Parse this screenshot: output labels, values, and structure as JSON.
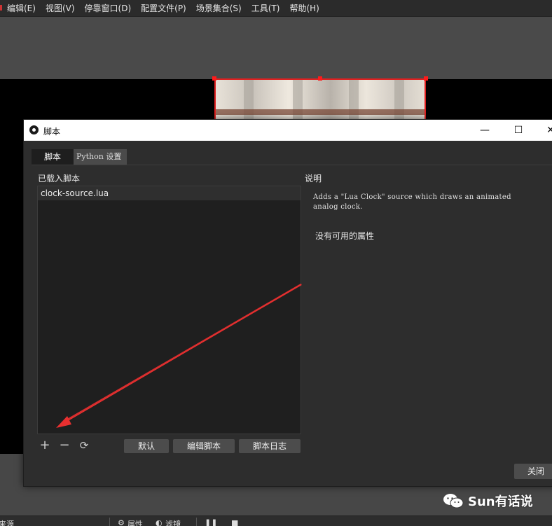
{
  "menu": {
    "items": [
      "编辑(E)",
      "视图(V)",
      "停靠窗口(D)",
      "配置文件(P)",
      "场景集合(S)",
      "工具(T)",
      "帮助(H)"
    ]
  },
  "dialog": {
    "title": "脚本",
    "controls": {
      "minimize": "—",
      "maximize": "☐",
      "close": "✕"
    },
    "tabs": [
      "脚本",
      "Python 设置"
    ],
    "loaded_scripts_label": "已载入脚本",
    "scripts": [
      "clock-source.lua"
    ],
    "toolbar": {
      "add": "+",
      "remove": "−",
      "reload": "⟳",
      "defaults_label": "默认",
      "edit_script_label": "编辑脚本",
      "script_log_label": "脚本日志"
    },
    "description_label": "说明",
    "description_text": "Adds a \"Lua Clock\" source which draws an animated analog clock.",
    "no_properties": "没有可用的属性",
    "close_label": "关闭"
  },
  "docks": {
    "sources_label": "来源",
    "properties_label": "属性",
    "filters_label": "滤镜"
  },
  "watermark": {
    "text": "Sun有话说"
  },
  "colors": {
    "accent_red": "#e02020",
    "dialog_bg": "#2d2d2d",
    "list_bg": "#1f1f1f",
    "titlebar": "#ffffff"
  },
  "icons": {
    "app_logo": "obs-logo-icon",
    "annotation": "red-arrow-icon",
    "watermark": "wechat-icon"
  }
}
